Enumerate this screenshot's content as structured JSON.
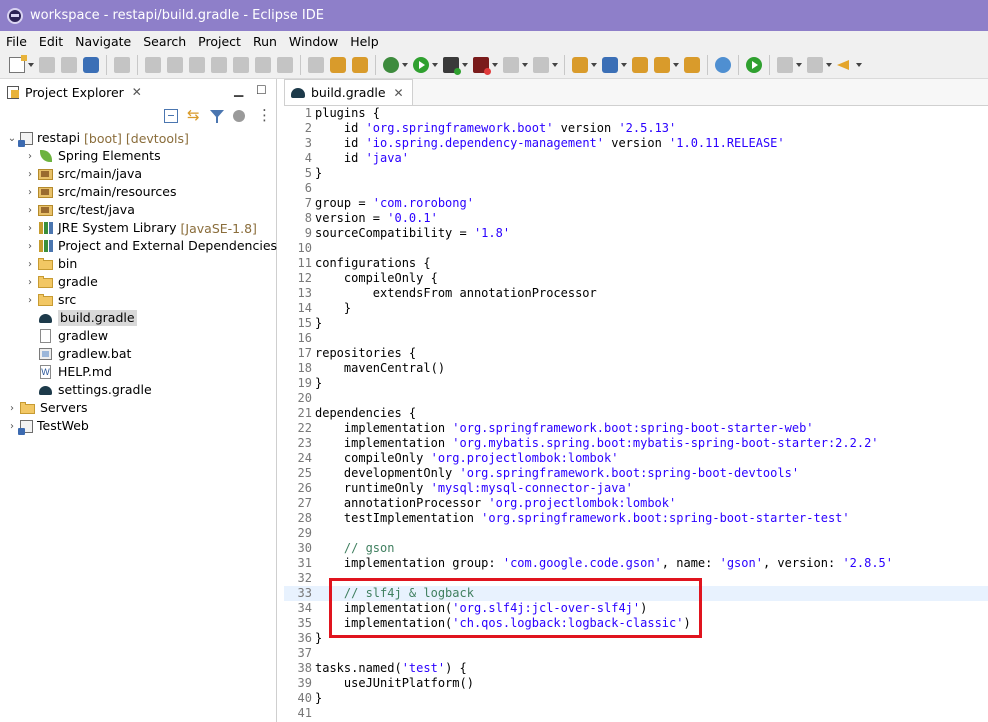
{
  "window": {
    "title": "workspace - restapi/build.gradle - Eclipse IDE"
  },
  "menu": [
    "File",
    "Edit",
    "Navigate",
    "Search",
    "Project",
    "Run",
    "Window",
    "Help"
  ],
  "explorer": {
    "title": "Project Explorer",
    "tree": [
      {
        "label": "restapi",
        "decoration": "[boot] [devtools]",
        "icon": "project-icon",
        "expanded": true,
        "level": 0
      },
      {
        "label": "Spring Elements",
        "icon": "spring-leaf-icon",
        "level": 1
      },
      {
        "label": "src/main/java",
        "icon": "package-folder-icon",
        "level": 1
      },
      {
        "label": "src/main/resources",
        "icon": "package-folder-icon",
        "level": 1
      },
      {
        "label": "src/test/java",
        "icon": "package-folder-icon",
        "level": 1
      },
      {
        "label": "JRE System Library",
        "decoration": "[JavaSE-1.8]",
        "icon": "library-icon",
        "level": 1
      },
      {
        "label": "Project and External Dependencies",
        "icon": "library-icon",
        "level": 1
      },
      {
        "label": "bin",
        "icon": "folder-icon",
        "level": 1
      },
      {
        "label": "gradle",
        "icon": "folder-icon",
        "level": 1
      },
      {
        "label": "src",
        "icon": "folder-icon",
        "level": 1
      },
      {
        "label": "build.gradle",
        "icon": "gradle-file-icon",
        "level": 1,
        "selected": true,
        "leaf": true
      },
      {
        "label": "gradlew",
        "icon": "file-icon",
        "level": 1,
        "leaf": true
      },
      {
        "label": "gradlew.bat",
        "icon": "bat-file-icon",
        "level": 1,
        "leaf": true
      },
      {
        "label": "HELP.md",
        "icon": "markdown-file-icon",
        "level": 1,
        "leaf": true
      },
      {
        "label": "settings.gradle",
        "icon": "gradle-file-icon",
        "level": 1,
        "leaf": true
      },
      {
        "label": "Servers",
        "icon": "folder-icon",
        "level": 0
      },
      {
        "label": "TestWeb",
        "icon": "project-icon",
        "level": 0
      }
    ]
  },
  "editor": {
    "tab": "build.gradle",
    "current_line": 33,
    "lines": [
      [
        [
          "t",
          "plugins {"
        ]
      ],
      [
        [
          "t",
          "    id "
        ],
        [
          "s",
          "'org.springframework.boot'"
        ],
        [
          "t",
          " version "
        ],
        [
          "s",
          "'2.5.13'"
        ]
      ],
      [
        [
          "t",
          "    id "
        ],
        [
          "s",
          "'io.spring.dependency-management'"
        ],
        [
          "t",
          " version "
        ],
        [
          "s",
          "'1.0.11.RELEASE'"
        ]
      ],
      [
        [
          "t",
          "    id "
        ],
        [
          "s",
          "'java'"
        ]
      ],
      [
        [
          "t",
          "}"
        ]
      ],
      [
        [
          "t",
          ""
        ]
      ],
      [
        [
          "t",
          "group = "
        ],
        [
          "s",
          "'com.rorobong'"
        ]
      ],
      [
        [
          "t",
          "version = "
        ],
        [
          "s",
          "'0.0.1'"
        ]
      ],
      [
        [
          "t",
          "sourceCompatibility = "
        ],
        [
          "s",
          "'1.8'"
        ]
      ],
      [
        [
          "t",
          ""
        ]
      ],
      [
        [
          "t",
          "configurations {"
        ]
      ],
      [
        [
          "t",
          "    compileOnly {"
        ]
      ],
      [
        [
          "t",
          "        extendsFrom annotationProcessor"
        ]
      ],
      [
        [
          "t",
          "    }"
        ]
      ],
      [
        [
          "t",
          "}"
        ]
      ],
      [
        [
          "t",
          ""
        ]
      ],
      [
        [
          "t",
          "repositories {"
        ]
      ],
      [
        [
          "t",
          "    mavenCentral()"
        ]
      ],
      [
        [
          "t",
          "}"
        ]
      ],
      [
        [
          "t",
          ""
        ]
      ],
      [
        [
          "t",
          "dependencies {"
        ]
      ],
      [
        [
          "t",
          "    implementation "
        ],
        [
          "s",
          "'org.springframework.boot:spring-boot-starter-web'"
        ]
      ],
      [
        [
          "t",
          "    implementation "
        ],
        [
          "s",
          "'org.mybatis.spring.boot:mybatis-spring-boot-starter:2.2.2'"
        ]
      ],
      [
        [
          "t",
          "    compileOnly "
        ],
        [
          "s",
          "'org.projectlombok:lombok'"
        ]
      ],
      [
        [
          "t",
          "    developmentOnly "
        ],
        [
          "s",
          "'org.springframework.boot:spring-boot-devtools'"
        ]
      ],
      [
        [
          "t",
          "    runtimeOnly "
        ],
        [
          "s",
          "'mysql:mysql-connector-java'"
        ]
      ],
      [
        [
          "t",
          "    annotationProcessor "
        ],
        [
          "s",
          "'org.projectlombok:lombok'"
        ]
      ],
      [
        [
          "t",
          "    testImplementation "
        ],
        [
          "s",
          "'org.springframework.boot:spring-boot-starter-test'"
        ]
      ],
      [
        [
          "t",
          ""
        ]
      ],
      [
        [
          "t",
          "    "
        ],
        [
          "c",
          "// gson"
        ]
      ],
      [
        [
          "t",
          "    implementation group: "
        ],
        [
          "s",
          "'com.google.code.gson'"
        ],
        [
          "t",
          ", name: "
        ],
        [
          "s",
          "'gson'"
        ],
        [
          "t",
          ", version: "
        ],
        [
          "s",
          "'2.8.5'"
        ]
      ],
      [
        [
          "t",
          ""
        ]
      ],
      [
        [
          "t",
          "    "
        ],
        [
          "c",
          "// slf4j & logback"
        ]
      ],
      [
        [
          "t",
          "    implementation("
        ],
        [
          "s",
          "'org.slf4j:jcl-over-slf4j'"
        ],
        [
          "t",
          ")"
        ]
      ],
      [
        [
          "t",
          "    implementation("
        ],
        [
          "s",
          "'ch.qos.logback:logback-classic'"
        ],
        [
          "t",
          ")"
        ]
      ],
      [
        [
          "t",
          "}"
        ]
      ],
      [
        [
          "t",
          ""
        ]
      ],
      [
        [
          "t",
          "tasks.named("
        ],
        [
          "s",
          "'test'"
        ],
        [
          "t",
          ") {"
        ]
      ],
      [
        [
          "t",
          "    useJUnitPlatform()"
        ]
      ],
      [
        [
          "t",
          "}"
        ]
      ],
      [
        [
          "t",
          ""
        ]
      ]
    ]
  },
  "highlight": {
    "color": "#e0141e",
    "from_line": 33,
    "to_line": 35
  },
  "colors": {
    "titlebar": "#8e7fc9",
    "string": "#2a00ff",
    "comment": "#3f7f5f",
    "current_line": "#e8f2fe"
  }
}
